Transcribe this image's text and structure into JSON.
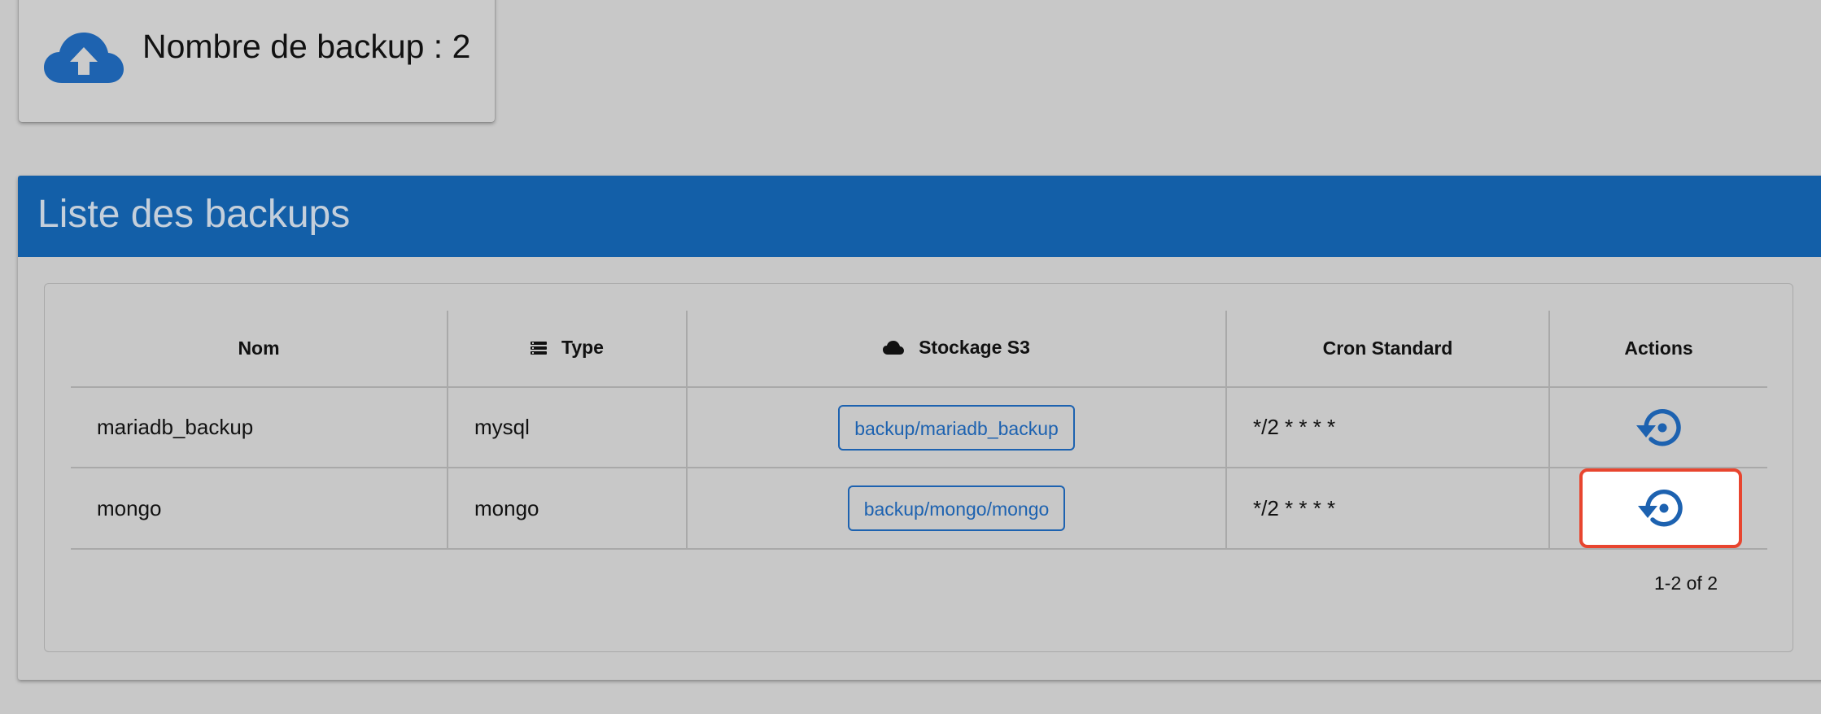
{
  "stat_card": {
    "text": "Nombre de backup : 2",
    "icon": "cloud-upload-icon",
    "icon_color": "#1e63b0"
  },
  "panel": {
    "title": "Liste des backups",
    "header_color": "#135fa8"
  },
  "table": {
    "columns": {
      "name": "Nom",
      "type": "Type",
      "type_icon": "list-icon",
      "storage": "Stockage S3",
      "storage_icon": "cloud-icon",
      "cron": "Cron Standard",
      "actions": "Actions"
    },
    "rows": [
      {
        "name": "mariadb_backup",
        "type": "mysql",
        "storage": "backup/mariadb_backup",
        "cron": "*/2 * * * *",
        "action_icon": "restore-icon"
      },
      {
        "name": "mongo",
        "type": "mongo",
        "storage": "backup/mongo/mongo",
        "cron": "*/2 * * * *",
        "action_icon": "restore-icon"
      }
    ],
    "pagination": "1-2 of 2"
  },
  "colors": {
    "accent": "#1d62b0",
    "highlight": "#e8452f",
    "background": "#c8c8c8"
  }
}
